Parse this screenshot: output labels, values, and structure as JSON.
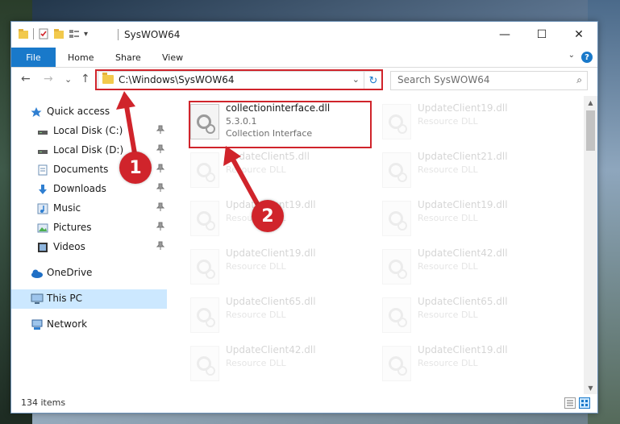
{
  "window": {
    "title": "SysWOW64",
    "controls": {
      "minimize": "—",
      "maximize": "☐",
      "close": "✕"
    }
  },
  "qat": {
    "dropdown": "▾"
  },
  "ribbon": {
    "tabs": [
      "File",
      "Home",
      "Share",
      "View"
    ],
    "collapse": "⌄",
    "help": "?"
  },
  "nav": {
    "back": "←",
    "forward": "→",
    "recent": "⌄",
    "up": "↑",
    "address": "C:\\Windows\\SysWOW64",
    "address_dropdown": "⌄",
    "refresh": "↻",
    "search_placeholder": "Search SysWOW64",
    "search_icon": "⌕"
  },
  "sidebar": {
    "items": [
      {
        "label": "Quick access",
        "icon": "star-icon",
        "pinned": false
      },
      {
        "label": "Local Disk (C:)",
        "icon": "drive-icon",
        "pinned": true
      },
      {
        "label": "Local Disk (D:)",
        "icon": "drive-icon",
        "pinned": true
      },
      {
        "label": "Documents",
        "icon": "documents-icon",
        "pinned": true
      },
      {
        "label": "Downloads",
        "icon": "download-icon",
        "pinned": true
      },
      {
        "label": "Music",
        "icon": "music-icon",
        "pinned": true
      },
      {
        "label": "Pictures",
        "icon": "pictures-icon",
        "pinned": true
      },
      {
        "label": "Videos",
        "icon": "videos-icon",
        "pinned": true
      },
      {
        "label": "OneDrive",
        "icon": "cloud-icon",
        "pinned": false
      },
      {
        "label": "This PC",
        "icon": "computer-icon",
        "pinned": false,
        "selected": true
      },
      {
        "label": "Network",
        "icon": "network-icon",
        "pinned": false
      }
    ],
    "pin_glyph": "📌"
  },
  "files": [
    {
      "name": "collectioninterface.dll",
      "line2": "5.3.0.1",
      "line3": "Collection Interface",
      "highlighted": true
    },
    {
      "name": "UpdateClient19.dll",
      "line2": "Resource DLL"
    },
    {
      "name": "UpdateClient5.dll",
      "line2": "Resource DLL"
    },
    {
      "name": "UpdateClient21.dll",
      "line2": "Resource DLL"
    },
    {
      "name": "UpdateClient19.dll",
      "line2": "Resource DLL"
    },
    {
      "name": "UpdateClient19.dll",
      "line2": "Resource DLL"
    },
    {
      "name": "UpdateClient19.dll",
      "line2": "Resource DLL"
    },
    {
      "name": "UpdateClient42.dll",
      "line2": "Resource DLL"
    },
    {
      "name": "UpdateClient65.dll",
      "line2": "Resource DLL"
    },
    {
      "name": "UpdateClient65.dll",
      "line2": "Resource DLL"
    },
    {
      "name": "UpdateClient42.dll",
      "line2": "Resource DLL"
    },
    {
      "name": "UpdateClient19.dll",
      "line2": "Resource DLL"
    }
  ],
  "status": {
    "item_count": "134 items"
  },
  "annotations": {
    "badge1": "1",
    "badge2": "2",
    "color": "#d0242b"
  },
  "colors": {
    "accent": "#1979ca",
    "selected": "#cce8ff"
  }
}
